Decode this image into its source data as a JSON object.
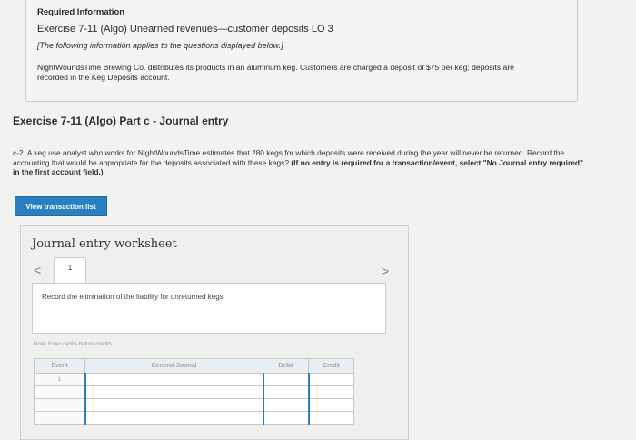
{
  "info": {
    "required_label": "Required Information",
    "exercise_title": "Exercise 7-11 (Algo) Unearned revenues—customer deposits LO 3",
    "applies_note": "[The following information applies to the questions displayed below.]",
    "description": "NightWoundsTime Brewing Co. distributes its products in an aluminum keg. Customers are charged a deposit of $75 per keg; deposits are recorded in the Keg Deposits account."
  },
  "part": {
    "title": "Exercise 7-11 (Algo) Part c - Journal entry",
    "question_text": "c-2. A keg use analyst who works for NightWoundsTime estimates that 280 kegs for which deposits were received during the year will never be returned. Record the accounting that would be appropriate for the deposits associated with these kegs? ",
    "question_bold": "(If no entry is required for a transaction/event, select \"No Journal entry required\" in the first account field.)"
  },
  "buttons": {
    "view_transaction_list": "View transaction list"
  },
  "worksheet": {
    "title": "Journal entry worksheet",
    "nav_prev": "<",
    "nav_next": ">",
    "tab_label": "1",
    "instruction": "Record the elimination of the liability for unreturned kegs.",
    "note": "Note: Enter debits before credits.",
    "table": {
      "headers": [
        "Event",
        "General Journal",
        "Debit",
        "Credit"
      ],
      "rows": [
        {
          "event": "1"
        },
        {
          "event": ""
        },
        {
          "event": ""
        },
        {
          "event": ""
        }
      ]
    }
  },
  "colors": {
    "accent": "#2a7fc1"
  }
}
